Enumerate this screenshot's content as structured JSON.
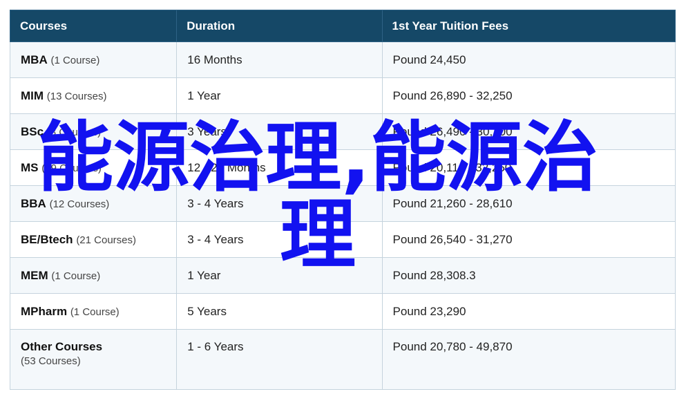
{
  "header": {
    "courses": "Courses",
    "duration": "Duration",
    "fees": "1st Year Tuition Fees"
  },
  "rows": [
    {
      "course": "MBA",
      "count": "(1 Course)",
      "duration": "16 Months",
      "fees": "Pound 24,450"
    },
    {
      "course": "MIM",
      "count": "(13 Courses)",
      "duration": "1 Year",
      "fees": "Pound 26,890 - 32,250"
    },
    {
      "course": "BSc",
      "count": "(3 Courses)",
      "duration": "3 Years",
      "fees": "Pound 26,490 - 30,100"
    },
    {
      "course": "MS",
      "count": "(39 Courses)",
      "duration": "12 - 24 Months",
      "fees": "Pound 20,110 - 32,250"
    },
    {
      "course": "BBA",
      "count": "(12 Courses)",
      "duration": "3 - 4 Years",
      "fees": "Pound 21,260 - 28,610"
    },
    {
      "course": "BE/Btech",
      "count": "(21 Courses)",
      "duration": "3 - 4 Years",
      "fees": "Pound 26,540 - 31,270"
    },
    {
      "course": "MEM",
      "count": "(1 Course)",
      "duration": "1 Year",
      "fees": "Pound 28,308.3"
    },
    {
      "course": "MPharm",
      "count": "(1 Course)",
      "duration": "5 Years",
      "fees": "Pound 23,290"
    },
    {
      "course": "Other Courses",
      "count": "(53 Courses)",
      "duration": "1 - 6 Years",
      "fees": "Pound 20,780 - 49,870"
    }
  ],
  "overlay_text": "能源治理,能源治理",
  "colors": {
    "header_bg": "#154867",
    "overlay": "#1212f0"
  }
}
